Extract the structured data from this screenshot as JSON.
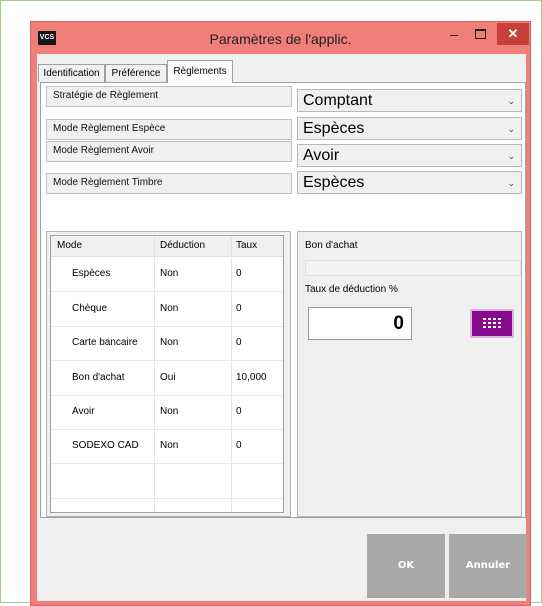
{
  "window": {
    "app_icon_text": "VCS",
    "title": "Paramètres de l'applic.",
    "minimize_glyph": "–",
    "close_glyph": "✕"
  },
  "tabs": [
    {
      "label": "Identification",
      "active": false
    },
    {
      "label": "Préférence",
      "active": false
    },
    {
      "label": "Règlements",
      "active": true
    }
  ],
  "settings": [
    {
      "label": "Stratégie de Règlement",
      "value": "Comptant"
    },
    {
      "label": "Mode  Règlement Espèce",
      "value": "Espèces"
    },
    {
      "label": "Mode Règlement Avoir",
      "value": "Avoir"
    },
    {
      "label": "Mode Règlement Timbre",
      "value": "Espèces"
    }
  ],
  "grid": {
    "columns": [
      "Mode",
      "Déduction",
      "Taux"
    ],
    "rows": [
      {
        "mode": "Espèces",
        "deduction": "Non",
        "taux": "0"
      },
      {
        "mode": "Chèque",
        "deduction": "Non",
        "taux": "0"
      },
      {
        "mode": "Carte bancaire",
        "deduction": "Non",
        "taux": "0"
      },
      {
        "mode": "Bon d'achat",
        "deduction": "Oui",
        "taux": "10,000"
      },
      {
        "mode": "Avoir",
        "deduction": "Non",
        "taux": "0"
      },
      {
        "mode": "SODEXO CAD",
        "deduction": "Non",
        "taux": "0"
      }
    ]
  },
  "detail": {
    "bon_label": "Bon d'achat",
    "bon_value": "",
    "taux_label": "Taux de déduction %",
    "taux_value": "0"
  },
  "buttons": {
    "ok": "OK",
    "cancel": "Annuler"
  },
  "colors": {
    "window_frame": "#f07f7a",
    "close_button": "#c7403a",
    "keypad_button": "#8a0a8d",
    "footer_button": "#a8a8a8"
  },
  "icons": {
    "keypad_icon": "keypad-icon",
    "dropdown_icon": "chevron-down-icon"
  }
}
